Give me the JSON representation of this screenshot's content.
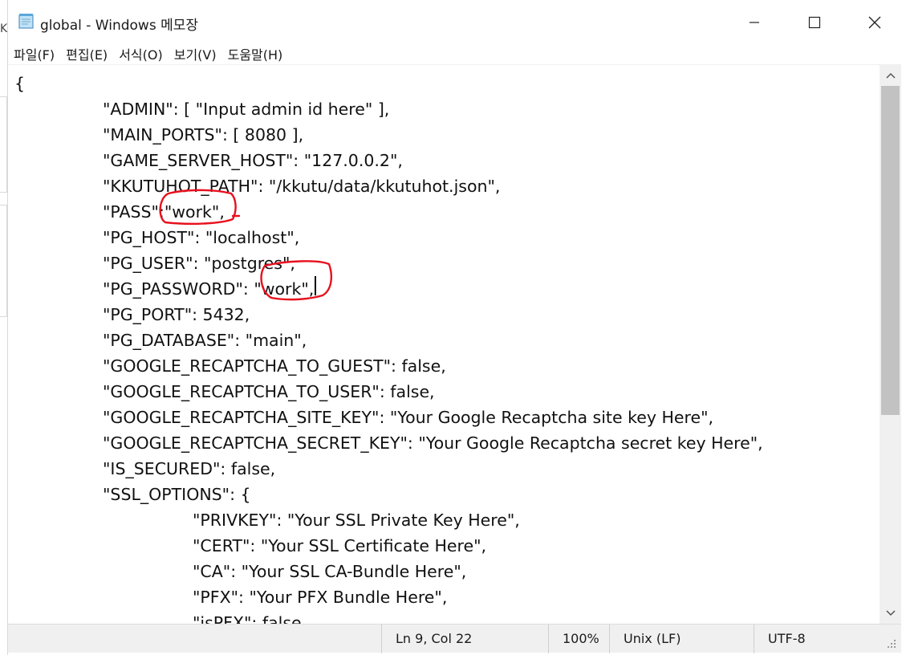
{
  "window": {
    "title": "global - Windows 메모장",
    "minimize_icon": "minimize-icon",
    "maximize_icon": "maximize-icon",
    "close_icon": "close-icon"
  },
  "behind_window": {
    "glyph": "K"
  },
  "menu": [
    {
      "label": "파일(F)"
    },
    {
      "label": "편집(E)"
    },
    {
      "label": "서식(O)"
    },
    {
      "label": "보기(V)"
    },
    {
      "label": "도움말(H)"
    }
  ],
  "editor": {
    "lines": [
      {
        "indent": 0,
        "text": "{"
      },
      {
        "indent": 1,
        "text": "\"ADMIN\": [ \"Input admin id here\" ],"
      },
      {
        "indent": 1,
        "text": "\"MAIN_PORTS\": [ 8080 ],"
      },
      {
        "indent": 1,
        "text": "\"GAME_SERVER_HOST\": \"127.0.0.2\","
      },
      {
        "indent": 1,
        "text": "\"KKUTUHOT_PATH\": \"/kkutu/data/kkutuhot.json\","
      },
      {
        "indent": 1,
        "text": "\"PASS\":\"work\","
      },
      {
        "indent": 1,
        "text": "\"PG_HOST\": \"localhost\","
      },
      {
        "indent": 1,
        "text": "\"PG_USER\": \"postgres\","
      },
      {
        "indent": 1,
        "text": "\"PG_PASSWORD\": \"work\","
      },
      {
        "indent": 1,
        "text": "\"PG_PORT\": 5432,"
      },
      {
        "indent": 1,
        "text": "\"PG_DATABASE\": \"main\","
      },
      {
        "indent": 1,
        "text": "\"GOOGLE_RECAPTCHA_TO_GUEST\": false,"
      },
      {
        "indent": 1,
        "text": "\"GOOGLE_RECAPTCHA_TO_USER\": false,"
      },
      {
        "indent": 1,
        "text": "\"GOOGLE_RECAPTCHA_SITE_KEY\": \"Your Google Recaptcha site key Here\","
      },
      {
        "indent": 1,
        "text": "\"GOOGLE_RECAPTCHA_SECRET_KEY\": \"Your Google Recaptcha secret key Here\","
      },
      {
        "indent": 1,
        "text": "\"IS_SECURED\": false,"
      },
      {
        "indent": 1,
        "text": "\"SSL_OPTIONS\": {"
      },
      {
        "indent": 2,
        "text": "\"PRIVKEY\": \"Your SSL Private Key Here\","
      },
      {
        "indent": 2,
        "text": "\"CERT\": \"Your SSL Certificate Here\","
      },
      {
        "indent": 2,
        "text": "\"CA\": \"Your SSL CA-Bundle Here\","
      },
      {
        "indent": 2,
        "text": "\"PFX\": \"Your PFX Bundle Here\","
      },
      {
        "indent": 2,
        "text": "\"isPFX\": false"
      }
    ],
    "annotation_color": "#e8101e"
  },
  "statusbar": {
    "position": "Ln 9, Col 22",
    "zoom": "100%",
    "line_ending": "Unix (LF)",
    "encoding": "UTF-8"
  }
}
